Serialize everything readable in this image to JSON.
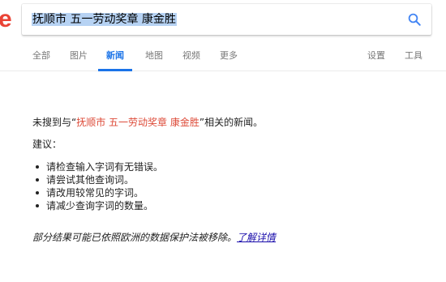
{
  "logo": {
    "fragment": "e"
  },
  "search": {
    "query": "抚顺市 五一劳动奖章 康金胜",
    "search_icon": "search-icon"
  },
  "tabs": [
    {
      "label": "全部",
      "active": false
    },
    {
      "label": "图片",
      "active": false
    },
    {
      "label": "新闻",
      "active": true
    },
    {
      "label": "地图",
      "active": false
    },
    {
      "label": "视频",
      "active": false
    },
    {
      "label": "更多",
      "active": false
    }
  ],
  "tools": {
    "settings_label": "设置",
    "tools_label": "工具"
  },
  "results": {
    "no_results_prefix": "未搜到与“",
    "no_results_query": "抚顺市 五一劳动奖章 康金胜",
    "no_results_suffix": "”相关的新闻。",
    "suggestions_title": "建议：",
    "suggestions": [
      "请检查输入字词有无错误。",
      "请尝试其他查询词。",
      "请改用较常见的字词。",
      "请减少查询字词的数量。"
    ],
    "footnote_text": "部分结果可能已依照欧洲的数据保护法被移除。",
    "footnote_link": "了解详情"
  },
  "colors": {
    "accent": "#1a73e8",
    "query_highlight": "#dd4b39",
    "link": "#1a0dab",
    "selection": "#b6d2f3"
  }
}
